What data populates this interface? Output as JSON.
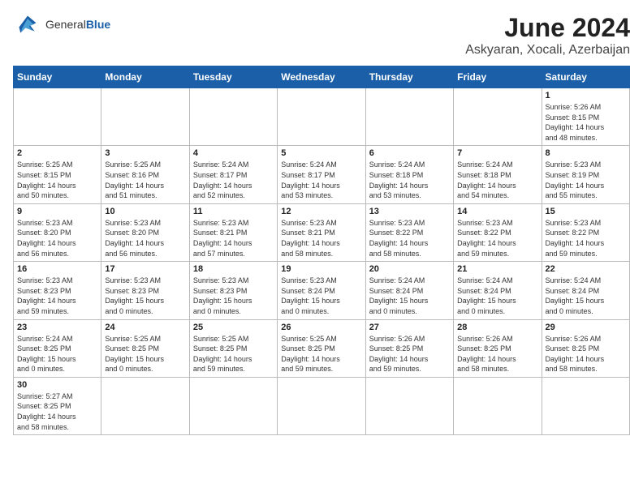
{
  "header": {
    "logo_general": "General",
    "logo_blue": "Blue",
    "month": "June 2024",
    "location": "Askyaran, Xocali, Azerbaijan"
  },
  "weekdays": [
    "Sunday",
    "Monday",
    "Tuesday",
    "Wednesday",
    "Thursday",
    "Friday",
    "Saturday"
  ],
  "weeks": [
    [
      {
        "day": "",
        "info": ""
      },
      {
        "day": "",
        "info": ""
      },
      {
        "day": "",
        "info": ""
      },
      {
        "day": "",
        "info": ""
      },
      {
        "day": "",
        "info": ""
      },
      {
        "day": "",
        "info": ""
      },
      {
        "day": "1",
        "info": "Sunrise: 5:26 AM\nSunset: 8:15 PM\nDaylight: 14 hours\nand 48 minutes."
      }
    ],
    [
      {
        "day": "2",
        "info": "Sunrise: 5:25 AM\nSunset: 8:15 PM\nDaylight: 14 hours\nand 50 minutes."
      },
      {
        "day": "3",
        "info": "Sunrise: 5:25 AM\nSunset: 8:16 PM\nDaylight: 14 hours\nand 51 minutes."
      },
      {
        "day": "4",
        "info": "Sunrise: 5:24 AM\nSunset: 8:17 PM\nDaylight: 14 hours\nand 52 minutes."
      },
      {
        "day": "5",
        "info": "Sunrise: 5:24 AM\nSunset: 8:17 PM\nDaylight: 14 hours\nand 53 minutes."
      },
      {
        "day": "6",
        "info": "Sunrise: 5:24 AM\nSunset: 8:18 PM\nDaylight: 14 hours\nand 53 minutes."
      },
      {
        "day": "7",
        "info": "Sunrise: 5:24 AM\nSunset: 8:18 PM\nDaylight: 14 hours\nand 54 minutes."
      },
      {
        "day": "8",
        "info": "Sunrise: 5:23 AM\nSunset: 8:19 PM\nDaylight: 14 hours\nand 55 minutes."
      }
    ],
    [
      {
        "day": "9",
        "info": "Sunrise: 5:23 AM\nSunset: 8:20 PM\nDaylight: 14 hours\nand 56 minutes."
      },
      {
        "day": "10",
        "info": "Sunrise: 5:23 AM\nSunset: 8:20 PM\nDaylight: 14 hours\nand 56 minutes."
      },
      {
        "day": "11",
        "info": "Sunrise: 5:23 AM\nSunset: 8:21 PM\nDaylight: 14 hours\nand 57 minutes."
      },
      {
        "day": "12",
        "info": "Sunrise: 5:23 AM\nSunset: 8:21 PM\nDaylight: 14 hours\nand 58 minutes."
      },
      {
        "day": "13",
        "info": "Sunrise: 5:23 AM\nSunset: 8:22 PM\nDaylight: 14 hours\nand 58 minutes."
      },
      {
        "day": "14",
        "info": "Sunrise: 5:23 AM\nSunset: 8:22 PM\nDaylight: 14 hours\nand 59 minutes."
      },
      {
        "day": "15",
        "info": "Sunrise: 5:23 AM\nSunset: 8:22 PM\nDaylight: 14 hours\nand 59 minutes."
      }
    ],
    [
      {
        "day": "16",
        "info": "Sunrise: 5:23 AM\nSunset: 8:23 PM\nDaylight: 14 hours\nand 59 minutes."
      },
      {
        "day": "17",
        "info": "Sunrise: 5:23 AM\nSunset: 8:23 PM\nDaylight: 15 hours\nand 0 minutes."
      },
      {
        "day": "18",
        "info": "Sunrise: 5:23 AM\nSunset: 8:23 PM\nDaylight: 15 hours\nand 0 minutes."
      },
      {
        "day": "19",
        "info": "Sunrise: 5:23 AM\nSunset: 8:24 PM\nDaylight: 15 hours\nand 0 minutes."
      },
      {
        "day": "20",
        "info": "Sunrise: 5:24 AM\nSunset: 8:24 PM\nDaylight: 15 hours\nand 0 minutes."
      },
      {
        "day": "21",
        "info": "Sunrise: 5:24 AM\nSunset: 8:24 PM\nDaylight: 15 hours\nand 0 minutes."
      },
      {
        "day": "22",
        "info": "Sunrise: 5:24 AM\nSunset: 8:24 PM\nDaylight: 15 hours\nand 0 minutes."
      }
    ],
    [
      {
        "day": "23",
        "info": "Sunrise: 5:24 AM\nSunset: 8:25 PM\nDaylight: 15 hours\nand 0 minutes."
      },
      {
        "day": "24",
        "info": "Sunrise: 5:25 AM\nSunset: 8:25 PM\nDaylight: 15 hours\nand 0 minutes."
      },
      {
        "day": "25",
        "info": "Sunrise: 5:25 AM\nSunset: 8:25 PM\nDaylight: 14 hours\nand 59 minutes."
      },
      {
        "day": "26",
        "info": "Sunrise: 5:25 AM\nSunset: 8:25 PM\nDaylight: 14 hours\nand 59 minutes."
      },
      {
        "day": "27",
        "info": "Sunrise: 5:26 AM\nSunset: 8:25 PM\nDaylight: 14 hours\nand 59 minutes."
      },
      {
        "day": "28",
        "info": "Sunrise: 5:26 AM\nSunset: 8:25 PM\nDaylight: 14 hours\nand 58 minutes."
      },
      {
        "day": "29",
        "info": "Sunrise: 5:26 AM\nSunset: 8:25 PM\nDaylight: 14 hours\nand 58 minutes."
      }
    ],
    [
      {
        "day": "30",
        "info": "Sunrise: 5:27 AM\nSunset: 8:25 PM\nDaylight: 14 hours\nand 58 minutes."
      },
      {
        "day": "",
        "info": ""
      },
      {
        "day": "",
        "info": ""
      },
      {
        "day": "",
        "info": ""
      },
      {
        "day": "",
        "info": ""
      },
      {
        "day": "",
        "info": ""
      },
      {
        "day": "",
        "info": ""
      }
    ]
  ]
}
